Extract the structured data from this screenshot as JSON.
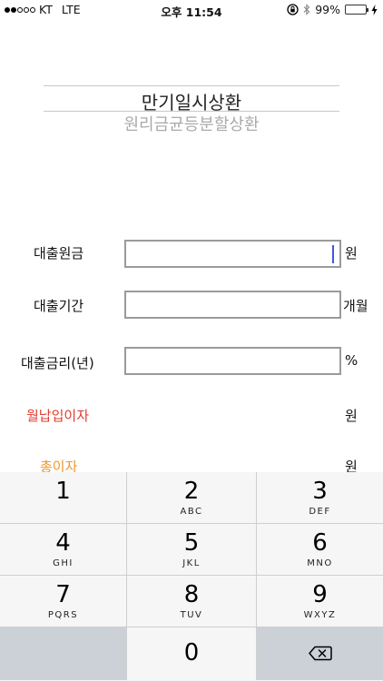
{
  "status_bar": {
    "carrier": "KT",
    "network": "LTE",
    "time": "오후 11:54",
    "battery_percent": "99%",
    "battery_level": 0.99,
    "battery_color": "#2fc244"
  },
  "picker": {
    "selected": "만기일시상환",
    "next": "원리금균등분할상환"
  },
  "form": {
    "principal_label": "대출원금",
    "principal_value": "",
    "principal_unit": "원",
    "period_label": "대출기간",
    "period_value": "",
    "period_unit": "개월",
    "rate_label": "대출금리(년)",
    "rate_value": "",
    "rate_unit": "%",
    "monthly_interest_label": "월납입이자",
    "monthly_interest_unit": "원",
    "total_interest_label": "총이자",
    "total_interest_unit": "원"
  },
  "keypad": {
    "keys": [
      {
        "num": "1",
        "letters": ""
      },
      {
        "num": "2",
        "letters": "ABC"
      },
      {
        "num": "3",
        "letters": "DEF"
      },
      {
        "num": "4",
        "letters": "GHI"
      },
      {
        "num": "5",
        "letters": "JKL"
      },
      {
        "num": "6",
        "letters": "MNO"
      },
      {
        "num": "7",
        "letters": "PQRS"
      },
      {
        "num": "8",
        "letters": "TUV"
      },
      {
        "num": "9",
        "letters": "WXYZ"
      },
      {
        "num": "0",
        "letters": ""
      }
    ],
    "delete_icon": "backspace-icon"
  },
  "colors": {
    "accent_red": "#e23b2e",
    "accent_orange": "#f0962c",
    "caret": "#3a5bd9"
  }
}
